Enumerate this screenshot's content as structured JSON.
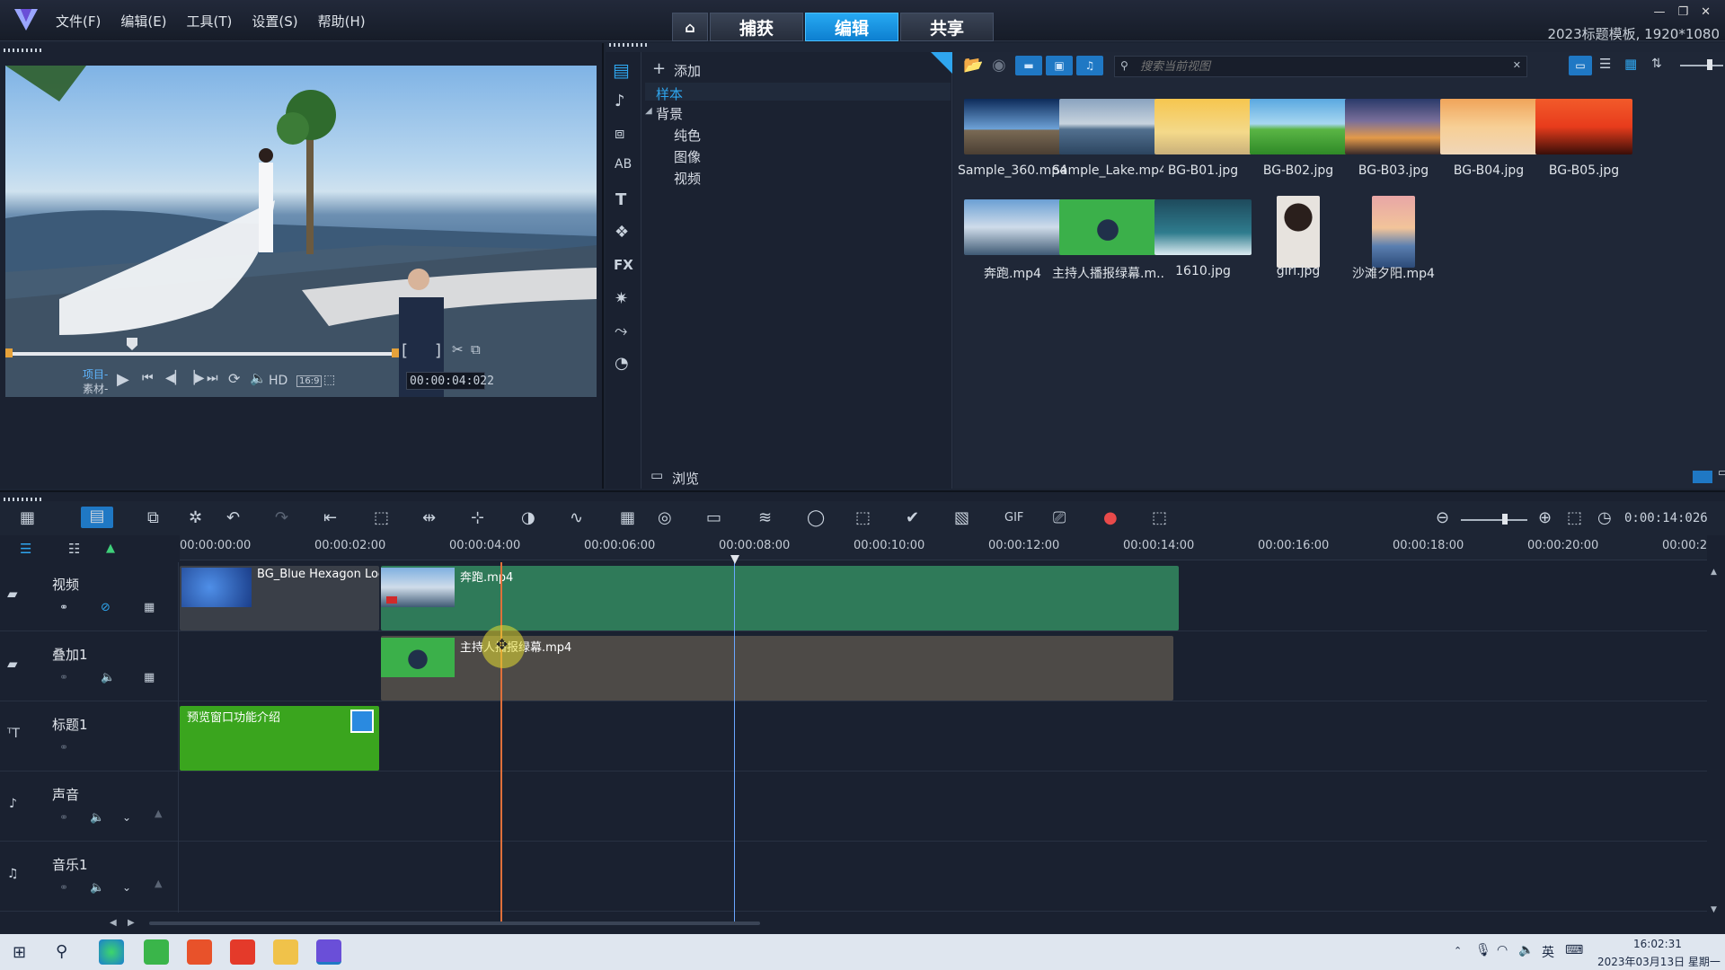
{
  "menu": {
    "file": "文件(F)",
    "edit": "编辑(E)",
    "tools": "工具(T)",
    "settings": "设置(S)",
    "help": "帮助(H)"
  },
  "modes": {
    "home_icon": "home-icon",
    "capture": "捕获",
    "edit": "编辑",
    "share": "共享"
  },
  "project_info": "2023标题模板, 1920*1080",
  "preview": {
    "project_label": "项目-",
    "clip_label": "素材-",
    "hd": "HD",
    "aspect": "16:9",
    "timecode": "00:00:04:022",
    "mark_in": "[",
    "mark_out": "]"
  },
  "library": {
    "add_label": "添加",
    "browse_label": "浏览",
    "search_placeholder": "搜索当前视图",
    "tree": {
      "sample": "样本",
      "background": "背景",
      "solid": "纯色",
      "image": "图像",
      "video": "视频"
    },
    "items": [
      {
        "name": "Sample_360.mp4",
        "kind": "video"
      },
      {
        "name": "Sample_Lake.mp4",
        "kind": "video"
      },
      {
        "name": "BG-B01.jpg",
        "kind": "image"
      },
      {
        "name": "BG-B02.jpg",
        "kind": "image"
      },
      {
        "name": "BG-B03.jpg",
        "kind": "image"
      },
      {
        "name": "BG-B04.jpg",
        "kind": "image"
      },
      {
        "name": "BG-B05.jpg",
        "kind": "image"
      },
      {
        "name": "奔跑.mp4",
        "kind": "video"
      },
      {
        "name": "主持人播报绿幕.m...",
        "kind": "video"
      },
      {
        "name": "1610.jpg",
        "kind": "image"
      },
      {
        "name": "girl.jpg",
        "kind": "image"
      },
      {
        "name": "沙滩夕阳.mp4",
        "kind": "video"
      }
    ]
  },
  "timeline": {
    "duration": "0:00:14:026",
    "ruler": [
      "00:00:00:00",
      "00:00:02:00",
      "00:00:04:00",
      "00:00:06:00",
      "00:00:08:00",
      "00:00:10:00",
      "00:00:12:00",
      "00:00:14:00",
      "00:00:16:00",
      "00:00:18:00",
      "00:00:20:00",
      "00:00:2"
    ],
    "tracks": {
      "video": "视频",
      "overlay": "叠加1",
      "title": "标题1",
      "voice": "声音",
      "music": "音乐1"
    },
    "clips": {
      "bg": "BG_Blue Hexagon Loo",
      "run": "奔跑.mp4",
      "host": "主持人播报绿幕.mp4",
      "title": "预览窗口功能介绍"
    }
  },
  "taskbar": {
    "time": "16:02:31",
    "date": "2023年03月13日 星期一",
    "ime": "英"
  }
}
